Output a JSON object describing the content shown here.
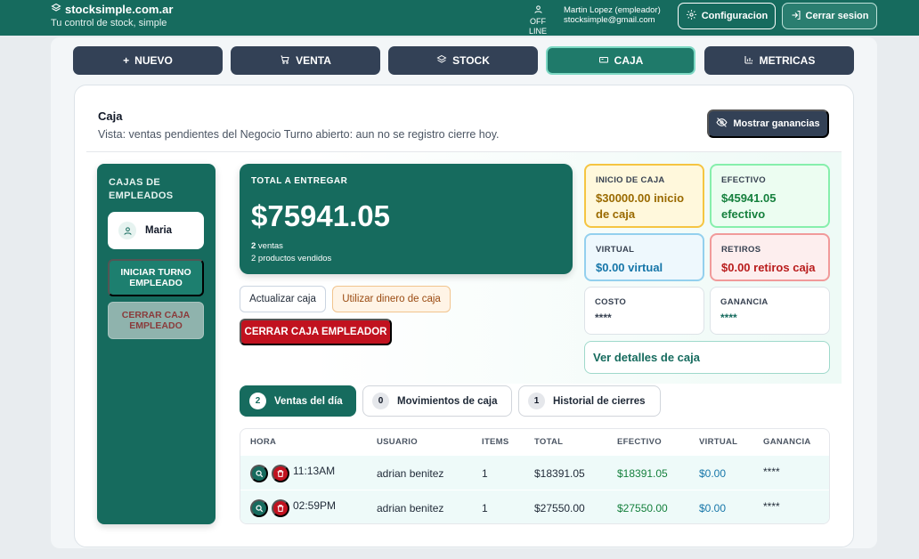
{
  "header": {
    "brand": "stocksimple.com.ar",
    "tagline": "Tu control de stock, simple",
    "status": "OFF LINE",
    "user_name": "Martin Lopez (empleador)",
    "user_email": "stocksimple@gmail.com",
    "config_label": "Configuracion",
    "logout_label": "Cerrar sesion"
  },
  "nav": {
    "nuevo": "NUEVO",
    "venta": "VENTA",
    "stock": "STOCK",
    "caja": "CAJA",
    "metricas": "METRICAS"
  },
  "page": {
    "title": "Caja",
    "subtitle": "Vista: ventas pendientes del Negocio  Turno abierto: aun no se registro cierre hoy.",
    "show_gains_label": "Mostrar ganancias"
  },
  "sidebar": {
    "title": "CAJAS DE EMPLEADOS",
    "employee": "Maria",
    "open_shift": "INICIAR TURNO EMPLEADO",
    "close_box": "CERRAR CAJA EMPLEADO"
  },
  "total": {
    "label": "TOTAL A ENTREGAR",
    "amount": "$75941.05",
    "sales_count": "2",
    "sales_suffix": " ventas",
    "products_line": "2 productos vendidos"
  },
  "actions": {
    "update": "Actualizar caja",
    "use_cash": "Utilizar dinero de caja",
    "close_employer": "CERRAR CAJA EMPLEADOR"
  },
  "stats": {
    "inicio": {
      "label": "INICIO DE CAJA",
      "value": "$30000.00 inicio de caja"
    },
    "efectivo": {
      "label": "EFECTIVO",
      "value": "$45941.05 efectivo"
    },
    "virtual": {
      "label": "VIRTUAL",
      "value": "$0.00 virtual"
    },
    "retiros": {
      "label": "RETIROS",
      "value": "$0.00 retiros caja"
    },
    "costo": {
      "label": "COSTO",
      "value": "****"
    },
    "ganancia": {
      "label": "GANANCIA",
      "value": "****"
    }
  },
  "details_label": "Ver detalles de caja",
  "tabs": [
    {
      "count": "2",
      "label": "Ventas del día"
    },
    {
      "count": "0",
      "label": "Movimientos de caja"
    },
    {
      "count": "1",
      "label": "Historial de cierres"
    }
  ],
  "table": {
    "headers": [
      "HORA",
      "USUARIO",
      "ITEMS",
      "TOTAL",
      "EFECTIVO",
      "VIRTUAL",
      "GANANCIA"
    ],
    "rows": [
      {
        "hora": "11:13AM",
        "usuario": "adrian benitez",
        "items": "1",
        "total": "$18391.05",
        "efectivo": "$18391.05",
        "virtual": "$0.00",
        "ganancia": "****"
      },
      {
        "hora": "02:59PM",
        "usuario": "adrian benitez",
        "items": "1",
        "total": "$27550.00",
        "efectivo": "$27550.00",
        "virtual": "$0.00",
        "ganancia": "****"
      }
    ]
  },
  "colors": {
    "primary": "#166b5e",
    "dark": "#334156",
    "danger": "#c1121f"
  }
}
